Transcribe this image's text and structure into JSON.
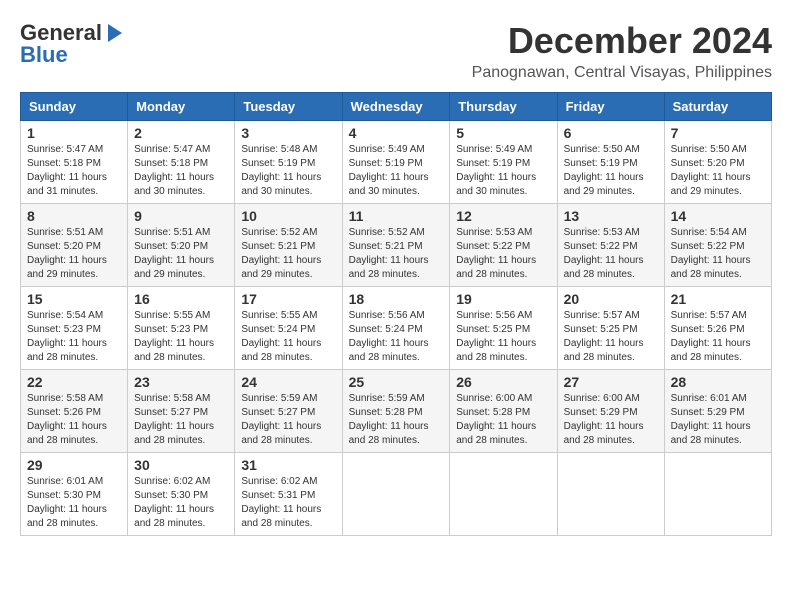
{
  "logo": {
    "line1": "General",
    "line2": "Blue"
  },
  "header": {
    "month": "December 2024",
    "location": "Panognawan, Central Visayas, Philippines"
  },
  "weekdays": [
    "Sunday",
    "Monday",
    "Tuesday",
    "Wednesday",
    "Thursday",
    "Friday",
    "Saturday"
  ],
  "weeks": [
    [
      {
        "day": "1",
        "sunrise": "5:47 AM",
        "sunset": "5:18 PM",
        "daylight": "11 hours and 31 minutes."
      },
      {
        "day": "2",
        "sunrise": "5:47 AM",
        "sunset": "5:18 PM",
        "daylight": "11 hours and 30 minutes."
      },
      {
        "day": "3",
        "sunrise": "5:48 AM",
        "sunset": "5:19 PM",
        "daylight": "11 hours and 30 minutes."
      },
      {
        "day": "4",
        "sunrise": "5:49 AM",
        "sunset": "5:19 PM",
        "daylight": "11 hours and 30 minutes."
      },
      {
        "day": "5",
        "sunrise": "5:49 AM",
        "sunset": "5:19 PM",
        "daylight": "11 hours and 30 minutes."
      },
      {
        "day": "6",
        "sunrise": "5:50 AM",
        "sunset": "5:19 PM",
        "daylight": "11 hours and 29 minutes."
      },
      {
        "day": "7",
        "sunrise": "5:50 AM",
        "sunset": "5:20 PM",
        "daylight": "11 hours and 29 minutes."
      }
    ],
    [
      {
        "day": "8",
        "sunrise": "5:51 AM",
        "sunset": "5:20 PM",
        "daylight": "11 hours and 29 minutes."
      },
      {
        "day": "9",
        "sunrise": "5:51 AM",
        "sunset": "5:20 PM",
        "daylight": "11 hours and 29 minutes."
      },
      {
        "day": "10",
        "sunrise": "5:52 AM",
        "sunset": "5:21 PM",
        "daylight": "11 hours and 29 minutes."
      },
      {
        "day": "11",
        "sunrise": "5:52 AM",
        "sunset": "5:21 PM",
        "daylight": "11 hours and 28 minutes."
      },
      {
        "day": "12",
        "sunrise": "5:53 AM",
        "sunset": "5:22 PM",
        "daylight": "11 hours and 28 minutes."
      },
      {
        "day": "13",
        "sunrise": "5:53 AM",
        "sunset": "5:22 PM",
        "daylight": "11 hours and 28 minutes."
      },
      {
        "day": "14",
        "sunrise": "5:54 AM",
        "sunset": "5:22 PM",
        "daylight": "11 hours and 28 minutes."
      }
    ],
    [
      {
        "day": "15",
        "sunrise": "5:54 AM",
        "sunset": "5:23 PM",
        "daylight": "11 hours and 28 minutes."
      },
      {
        "day": "16",
        "sunrise": "5:55 AM",
        "sunset": "5:23 PM",
        "daylight": "11 hours and 28 minutes."
      },
      {
        "day": "17",
        "sunrise": "5:55 AM",
        "sunset": "5:24 PM",
        "daylight": "11 hours and 28 minutes."
      },
      {
        "day": "18",
        "sunrise": "5:56 AM",
        "sunset": "5:24 PM",
        "daylight": "11 hours and 28 minutes."
      },
      {
        "day": "19",
        "sunrise": "5:56 AM",
        "sunset": "5:25 PM",
        "daylight": "11 hours and 28 minutes."
      },
      {
        "day": "20",
        "sunrise": "5:57 AM",
        "sunset": "5:25 PM",
        "daylight": "11 hours and 28 minutes."
      },
      {
        "day": "21",
        "sunrise": "5:57 AM",
        "sunset": "5:26 PM",
        "daylight": "11 hours and 28 minutes."
      }
    ],
    [
      {
        "day": "22",
        "sunrise": "5:58 AM",
        "sunset": "5:26 PM",
        "daylight": "11 hours and 28 minutes."
      },
      {
        "day": "23",
        "sunrise": "5:58 AM",
        "sunset": "5:27 PM",
        "daylight": "11 hours and 28 minutes."
      },
      {
        "day": "24",
        "sunrise": "5:59 AM",
        "sunset": "5:27 PM",
        "daylight": "11 hours and 28 minutes."
      },
      {
        "day": "25",
        "sunrise": "5:59 AM",
        "sunset": "5:28 PM",
        "daylight": "11 hours and 28 minutes."
      },
      {
        "day": "26",
        "sunrise": "6:00 AM",
        "sunset": "5:28 PM",
        "daylight": "11 hours and 28 minutes."
      },
      {
        "day": "27",
        "sunrise": "6:00 AM",
        "sunset": "5:29 PM",
        "daylight": "11 hours and 28 minutes."
      },
      {
        "day": "28",
        "sunrise": "6:01 AM",
        "sunset": "5:29 PM",
        "daylight": "11 hours and 28 minutes."
      }
    ],
    [
      {
        "day": "29",
        "sunrise": "6:01 AM",
        "sunset": "5:30 PM",
        "daylight": "11 hours and 28 minutes."
      },
      {
        "day": "30",
        "sunrise": "6:02 AM",
        "sunset": "5:30 PM",
        "daylight": "11 hours and 28 minutes."
      },
      {
        "day": "31",
        "sunrise": "6:02 AM",
        "sunset": "5:31 PM",
        "daylight": "11 hours and 28 minutes."
      },
      null,
      null,
      null,
      null
    ]
  ]
}
